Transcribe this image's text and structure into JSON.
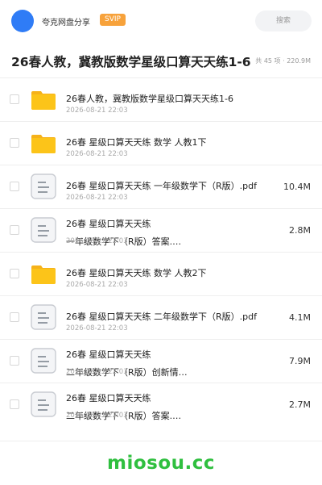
{
  "header": {
    "brand": "夸克网盘分享",
    "badge": "SVIP",
    "search_placeholder": "搜索"
  },
  "folder": {
    "title": "26春人教，冀教版数学星级口算天天练1-6",
    "meta": "共 45 项 · 220.9M"
  },
  "items": [
    {
      "type": "folder",
      "name": "26春人教，冀教版数学星级口算天天练1-6",
      "date": "2026-08-21 22:03",
      "size": ""
    },
    {
      "type": "folder",
      "name": "26春 星级口算天天练 数学 人教1下",
      "date": "2026-08-21 22:03",
      "size": ""
    },
    {
      "type": "file",
      "name": "26春 星级口算天天练 一年级数学下（R版）.pdf",
      "date": "2026-08-21 22:03",
      "size": "10.4M"
    },
    {
      "type": "file",
      "name": "26春 星级口算天天练\n一年级数学下（R版）答案.…",
      "date": "2026-08-21 22:03",
      "size": "2.8M"
    },
    {
      "type": "folder",
      "name": "26春 星级口算天天练 数学 人教2下",
      "date": "2026-08-21 22:03",
      "size": ""
    },
    {
      "type": "file",
      "name": "26春 星级口算天天练 二年级数学下（R版）.pdf",
      "date": "2026-08-21 22:03",
      "size": "4.1M"
    },
    {
      "type": "file",
      "name": "26春 星级口算天天练\n二年级数学下（R版）创新情…",
      "date": "2026-08-21 22:03",
      "size": "7.9M"
    },
    {
      "type": "file",
      "name": "26春 星级口算天天练\n二年级数学下（R版）答案.…",
      "date": "2026-08-21 22:03",
      "size": "2.7M"
    }
  ],
  "footer": {
    "site": "miosou.cc"
  },
  "colors": {
    "accent": "#2f7cf6",
    "badge": "#f7a23b",
    "folder": "#fcc419",
    "site": "#2fbf3f"
  }
}
